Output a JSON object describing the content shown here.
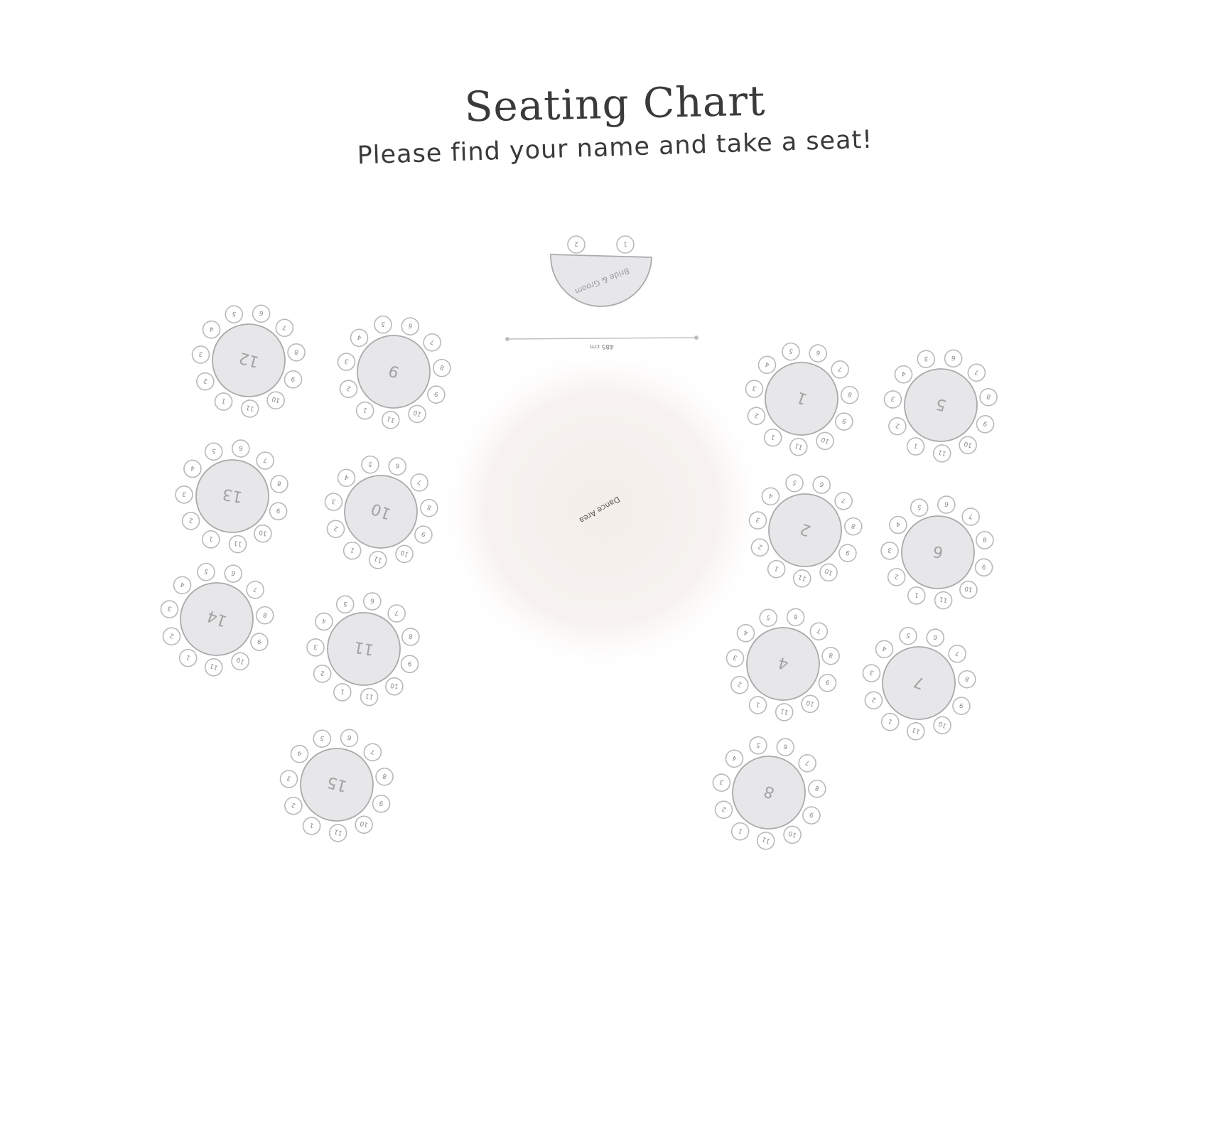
{
  "header": {
    "title": "Seating Chart",
    "subtitle": "Please find your name and take a seat!"
  },
  "head_table": {
    "label": "Bride & Groom",
    "seats": [
      "1",
      "2"
    ]
  },
  "measure": {
    "label": "485 cm"
  },
  "dance_floor": {
    "label": "Dance Area"
  },
  "colors": {
    "table_fill": "#e7e7ea",
    "table_stroke": "#aaaaaa",
    "seat_stroke": "#b9b9b9",
    "label_text": "#a3a3a3",
    "dance_floor": "#f4eeea"
  },
  "round_tables": [
    {
      "number": "12",
      "seats": [
        "1",
        "2",
        "3",
        "4",
        "5",
        "6",
        "7",
        "8",
        "9",
        "10",
        "11"
      ]
    },
    {
      "number": "9",
      "seats": [
        "1",
        "2",
        "3",
        "4",
        "5",
        "6",
        "7",
        "8",
        "9",
        "10",
        "11"
      ]
    },
    {
      "number": "13",
      "seats": [
        "1",
        "2",
        "3",
        "4",
        "5",
        "6",
        "7",
        "8",
        "9",
        "10",
        "11"
      ]
    },
    {
      "number": "10",
      "seats": [
        "1",
        "2",
        "3",
        "4",
        "5",
        "6",
        "7",
        "8",
        "9",
        "10",
        "11"
      ]
    },
    {
      "number": "14",
      "seats": [
        "1",
        "2",
        "3",
        "4",
        "5",
        "6",
        "7",
        "8",
        "9",
        "10",
        "11"
      ]
    },
    {
      "number": "11",
      "seats": [
        "1",
        "2",
        "3",
        "4",
        "5",
        "6",
        "7",
        "8",
        "9",
        "10",
        "11"
      ]
    },
    {
      "number": "15",
      "seats": [
        "1",
        "2",
        "3",
        "4",
        "5",
        "6",
        "7",
        "8",
        "9",
        "10",
        "11"
      ]
    },
    {
      "number": "1",
      "seats": [
        "1",
        "2",
        "3",
        "4",
        "5",
        "6",
        "7",
        "8",
        "9",
        "10",
        "11"
      ]
    },
    {
      "number": "5",
      "seats": [
        "1",
        "2",
        "3",
        "4",
        "5",
        "6",
        "7",
        "8",
        "9",
        "10",
        "11"
      ]
    },
    {
      "number": "2",
      "seats": [
        "1",
        "2",
        "3",
        "4",
        "5",
        "6",
        "7",
        "8",
        "9",
        "10",
        "11"
      ]
    },
    {
      "number": "6",
      "seats": [
        "1",
        "2",
        "3",
        "4",
        "5",
        "6",
        "7",
        "8",
        "9",
        "10",
        "11"
      ]
    },
    {
      "number": "4",
      "seats": [
        "1",
        "2",
        "3",
        "4",
        "5",
        "6",
        "7",
        "8",
        "9",
        "10",
        "11"
      ]
    },
    {
      "number": "7",
      "seats": [
        "1",
        "2",
        "3",
        "4",
        "5",
        "6",
        "7",
        "8",
        "9",
        "10",
        "11"
      ]
    },
    {
      "number": "8",
      "seats": [
        "1",
        "2",
        "3",
        "4",
        "5",
        "6",
        "7",
        "8",
        "9",
        "10",
        "11"
      ]
    }
  ]
}
